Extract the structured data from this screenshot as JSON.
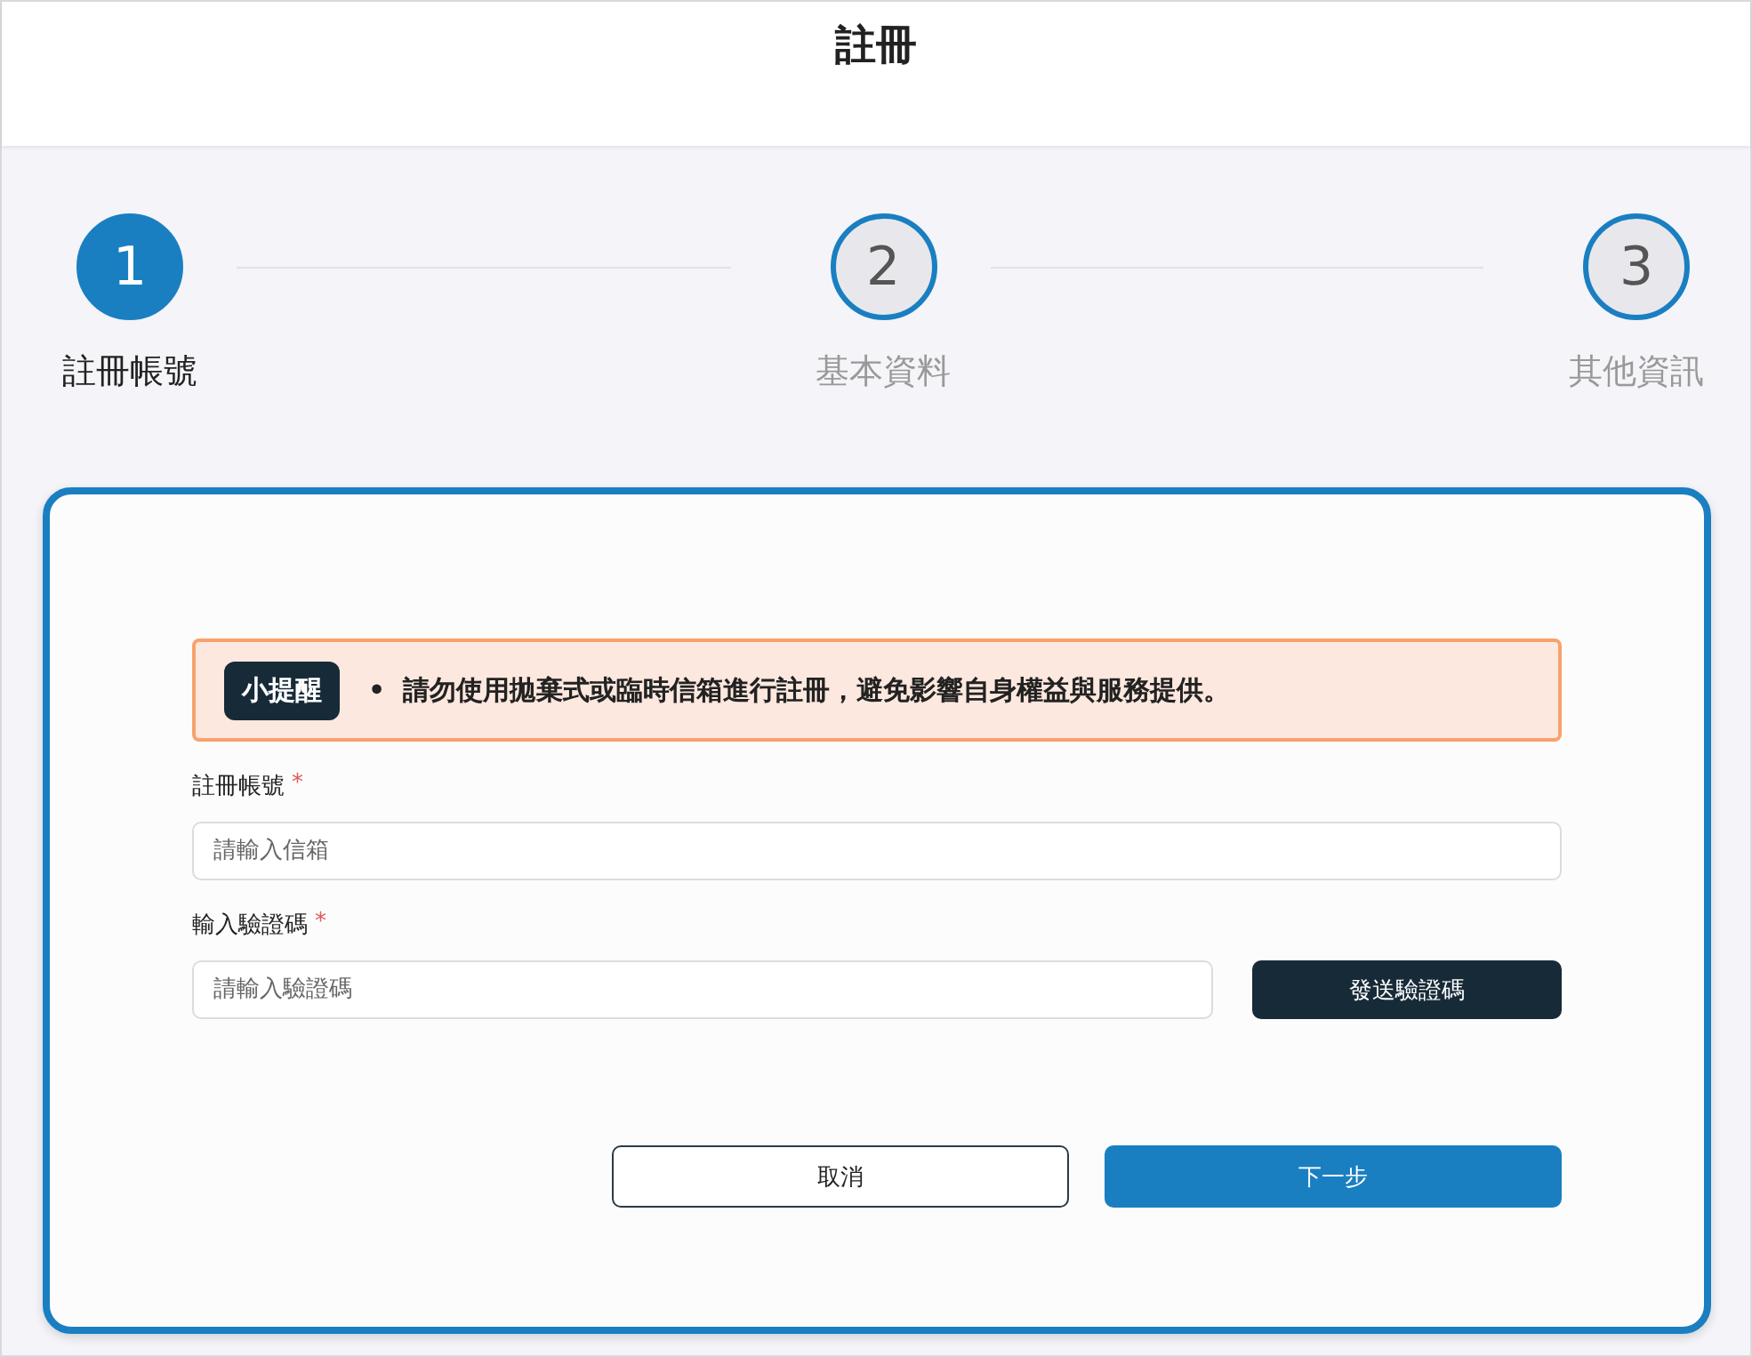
{
  "header": {
    "title": "註冊"
  },
  "steps": [
    {
      "number": "1",
      "label": "註冊帳號",
      "selected": true
    },
    {
      "number": "2",
      "label": "基本資料",
      "selected": false
    },
    {
      "number": "3",
      "label": "其他資訊",
      "selected": false
    }
  ],
  "notice": {
    "badge": "小提醒",
    "bullet": "•",
    "items": [
      "請勿使用拋棄式或臨時信箱進行註冊，避免影響自身權益與服務提供。"
    ]
  },
  "fields": [
    {
      "label": "註冊帳號",
      "marker": "*",
      "placeholder": "請輸入信箱"
    },
    {
      "label": "輸入驗證碼",
      "marker": "*",
      "placeholder": "請輸入驗證碼",
      "button": "發送驗證碼"
    }
  ],
  "actions": [
    {
      "label": "取消",
      "kind": "secondary"
    },
    {
      "label": "下一步",
      "kind": "primary"
    }
  ]
}
